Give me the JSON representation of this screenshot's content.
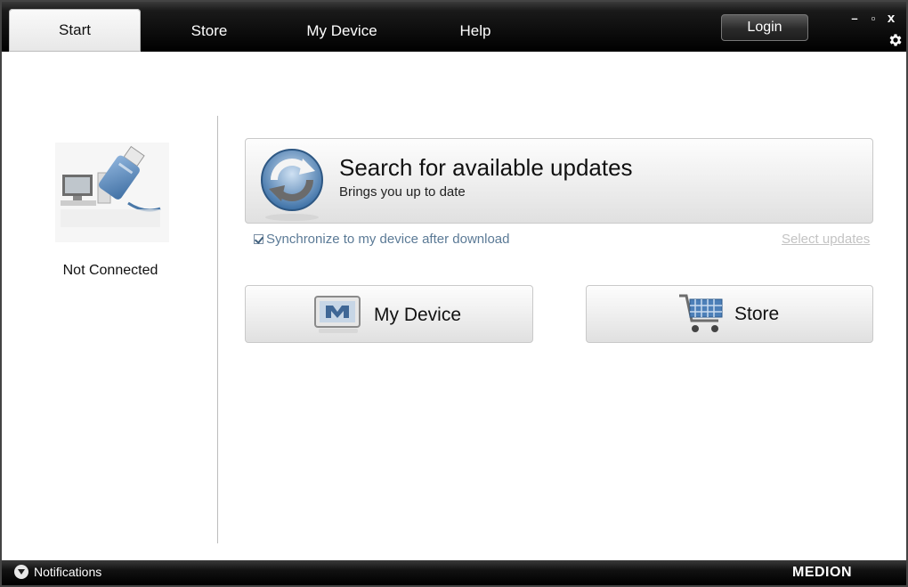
{
  "tabs": [
    {
      "label": "Start",
      "active": true
    },
    {
      "label": "Store",
      "active": false
    },
    {
      "label": "My Device",
      "active": false
    },
    {
      "label": "Help",
      "active": false
    }
  ],
  "header": {
    "login_label": "Login",
    "minimize": "–",
    "maximize": "▫",
    "close": "x",
    "settings_icon": "gear-icon"
  },
  "left_panel": {
    "device_icon": "usb-computer-icon",
    "status": "Not Connected"
  },
  "search": {
    "title": "Search for available updates",
    "subtitle": "Brings you up to date",
    "icon": "refresh-icon"
  },
  "sync": {
    "label": "Synchronize to my device after download",
    "checked": true
  },
  "select_updates_label": "Select updates",
  "buttons": {
    "my_device": "My Device",
    "store": "Store"
  },
  "footer": {
    "notifications_label": "Notifications",
    "brand": "MEDION"
  },
  "colors": {
    "titlebar": "#000000",
    "sync_text": "#5b7a96",
    "disabled_link": "#c3c3c3",
    "icon_blue": "#5b8cc0"
  }
}
